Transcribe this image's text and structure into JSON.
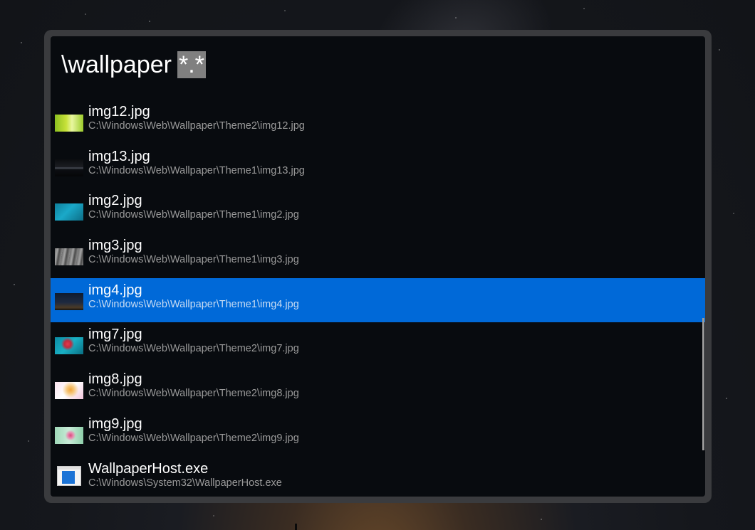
{
  "search": {
    "query": "\\wallpaper",
    "selected_text": "*.*"
  },
  "results": [
    {
      "name": "img12.jpg",
      "path": "C:\\Windows\\Web\\Wallpaper\\Theme2\\img12.jpg",
      "icon": "image-thumbnail"
    },
    {
      "name": "img13.jpg",
      "path": "C:\\Windows\\Web\\Wallpaper\\Theme1\\img13.jpg",
      "icon": "image-thumbnail"
    },
    {
      "name": "img2.jpg",
      "path": "C:\\Windows\\Web\\Wallpaper\\Theme1\\img2.jpg",
      "icon": "image-thumbnail"
    },
    {
      "name": "img3.jpg",
      "path": "C:\\Windows\\Web\\Wallpaper\\Theme1\\img3.jpg",
      "icon": "image-thumbnail"
    },
    {
      "name": "img4.jpg",
      "path": "C:\\Windows\\Web\\Wallpaper\\Theme1\\img4.jpg",
      "icon": "image-thumbnail",
      "selected": true
    },
    {
      "name": "img7.jpg",
      "path": "C:\\Windows\\Web\\Wallpaper\\Theme2\\img7.jpg",
      "icon": "image-thumbnail"
    },
    {
      "name": "img8.jpg",
      "path": "C:\\Windows\\Web\\Wallpaper\\Theme2\\img8.jpg",
      "icon": "image-thumbnail"
    },
    {
      "name": "img9.jpg",
      "path": "C:\\Windows\\Web\\Wallpaper\\Theme2\\img9.jpg",
      "icon": "image-thumbnail"
    },
    {
      "name": "WallpaperHost.exe",
      "path": "C:\\Windows\\System32\\WallpaperHost.exe",
      "icon": "exe-app-icon"
    }
  ],
  "colors": {
    "selection": "#0069d8",
    "panel_background": "#080b0f",
    "frame": "#3a3b3e",
    "secondary_text": "#9a9a9a"
  }
}
